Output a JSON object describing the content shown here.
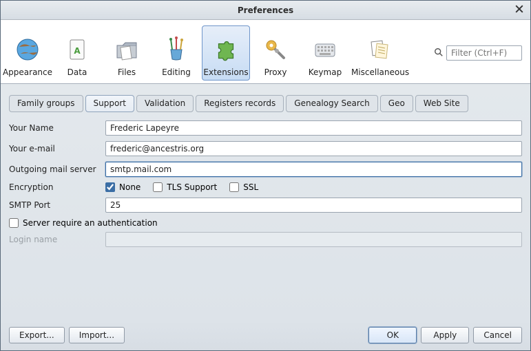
{
  "window": {
    "title": "Preferences"
  },
  "search": {
    "placeholder": "Filter (Ctrl+F)"
  },
  "toolbar": {
    "items": [
      {
        "id": "appearance",
        "label": "Appearance"
      },
      {
        "id": "data",
        "label": "Data"
      },
      {
        "id": "files",
        "label": "Files"
      },
      {
        "id": "editing",
        "label": "Editing"
      },
      {
        "id": "extensions",
        "label": "Extensions",
        "selected": true
      },
      {
        "id": "proxy",
        "label": "Proxy"
      },
      {
        "id": "keymap",
        "label": "Keymap"
      },
      {
        "id": "misc",
        "label": "Miscellaneous"
      }
    ]
  },
  "tabs": {
    "items": [
      {
        "id": "family",
        "label": "Family groups"
      },
      {
        "id": "support",
        "label": "Support",
        "active": true
      },
      {
        "id": "validation",
        "label": "Validation"
      },
      {
        "id": "registers",
        "label": "Registers records"
      },
      {
        "id": "genealogy",
        "label": "Genealogy Search"
      },
      {
        "id": "geo",
        "label": "Geo"
      },
      {
        "id": "website",
        "label": "Web Site"
      }
    ]
  },
  "form": {
    "name_label": "Your Name",
    "name_value": "Frederic Lapeyre",
    "email_label": "Your e-mail",
    "email_value": "frederic@ancestris.org",
    "server_label": "Outgoing mail server",
    "server_value": "smtp.mail.com",
    "encryption_label": "Encryption",
    "enc_none": "None",
    "enc_tls": "TLS Support",
    "enc_ssl": "SSL",
    "port_label": "SMTP Port",
    "port_value": "25",
    "auth_label": "Server require an authentication",
    "login_label": "Login name"
  },
  "buttons": {
    "export": "Export...",
    "import": "Import...",
    "ok": "OK",
    "apply": "Apply",
    "cancel": "Cancel"
  }
}
